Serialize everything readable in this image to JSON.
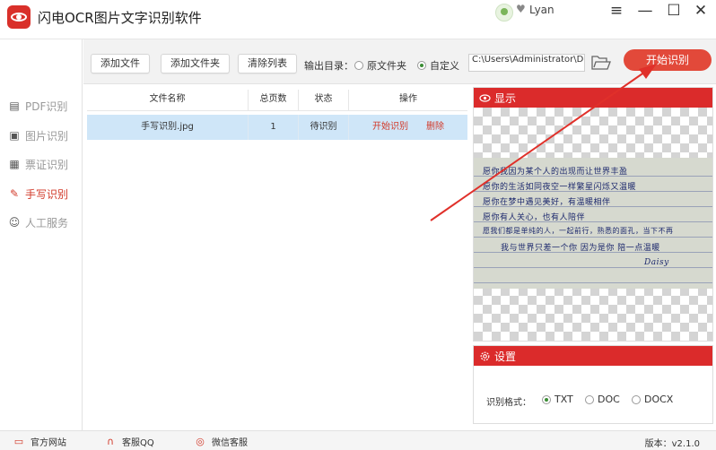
{
  "app": {
    "title": "闪电OCR图片文字识别软件",
    "username": "Lyan",
    "accent_color": "#db2b2b"
  },
  "window_controls": {
    "menu_icon": "≡",
    "minimize_icon": "—",
    "maximize_icon": "☐",
    "close_icon": "✕"
  },
  "sidebar": {
    "items": [
      {
        "label": "PDF识别",
        "icon": "pdf-icon"
      },
      {
        "label": "图片识别",
        "icon": "image-icon"
      },
      {
        "label": "票证识别",
        "icon": "id-card-icon"
      },
      {
        "label": "手写识别",
        "icon": "handwriting-icon",
        "active": true
      },
      {
        "label": "人工服务",
        "icon": "smiley-icon"
      }
    ]
  },
  "toolbar": {
    "add_file": "添加文件",
    "add_folder": "添加文件夹",
    "clear_list": "清除列表",
    "output_label": "输出目录：",
    "option_source": "原文件夹",
    "option_custom": "自定义",
    "output_path": "C:\\Users\\Administrator\\De",
    "start": "开始识别"
  },
  "table": {
    "headers": [
      "文件名称",
      "总页数",
      "状态",
      "操作"
    ],
    "rows": [
      {
        "name": "手写识别.jpg",
        "pages": "1",
        "status": "待识别",
        "action_start": "开始识别",
        "action_delete": "删除"
      }
    ]
  },
  "preview": {
    "title": "显示",
    "handwriting_lines": [
      "愿你我因为某个人的出现而让世界丰盈",
      "愿你的生活如同夜空一样繁星闪烁又温暖",
      "愿你在梦中遇见美好，有温暖相伴",
      "愿你有人关心，也有人陪伴",
      "愿我们都是单纯的人，一起前行，熟悉的面孔，当下不再",
      "我与世界只差一个你 因为是你 陪一点温暖",
      "Daisy"
    ]
  },
  "settings": {
    "title": "设置",
    "format_label": "识别格式：",
    "formats": [
      "TXT",
      "DOC",
      "DOCX"
    ],
    "selected_format": "TXT"
  },
  "statusbar": {
    "website": "官方网站",
    "qq_service": "客服QQ",
    "wechat_service": "微信客服",
    "version": "版本：v2.1.0"
  }
}
